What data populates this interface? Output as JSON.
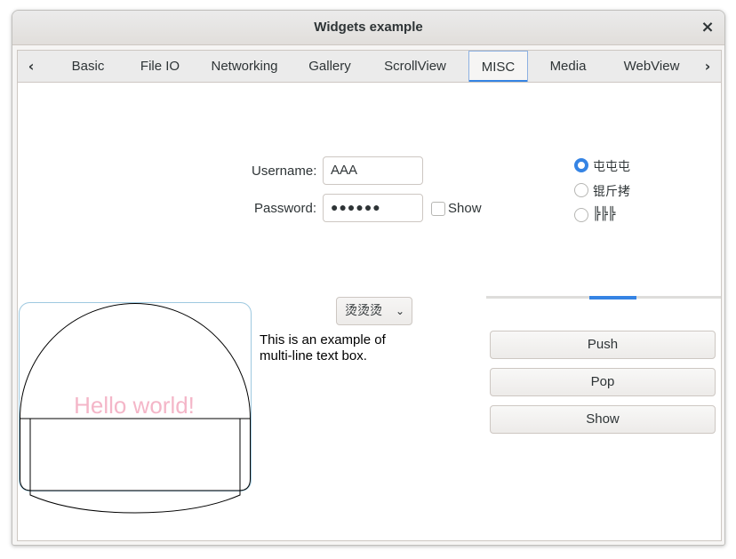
{
  "window": {
    "title": "Widgets example",
    "close_glyph": "×"
  },
  "tabs": [
    {
      "label": "Basic"
    },
    {
      "label": "File IO"
    },
    {
      "label": "Networking"
    },
    {
      "label": "Gallery"
    },
    {
      "label": "ScrollView"
    },
    {
      "label": "MISC",
      "active": true
    },
    {
      "label": "Media"
    },
    {
      "label": "WebView"
    }
  ],
  "tab_nav": {
    "prev_glyph": "‹",
    "next_glyph": "›"
  },
  "form": {
    "username_label": "Username:",
    "username_value": "AAA",
    "password_label": "Password:",
    "password_value": "●●●●●●",
    "show_label": "Show",
    "show_checked": false
  },
  "radios": [
    {
      "label": "屯屯屯",
      "selected": true
    },
    {
      "label": "锟斤拷",
      "selected": false
    },
    {
      "label": "╠╠╠",
      "selected": false
    }
  ],
  "combo": {
    "value": "烫烫烫",
    "chevron": "⌄"
  },
  "multiline_text": [
    "This is an example of",
    "multi-line text box."
  ],
  "canvas": {
    "text": "Hello world!",
    "text_color": "#f4b6c8"
  },
  "progress": {
    "fraction": 0.2
  },
  "buttons": {
    "push": "Push",
    "pop": "Pop",
    "show": "Show"
  },
  "colors": {
    "accent": "#3584e4"
  }
}
